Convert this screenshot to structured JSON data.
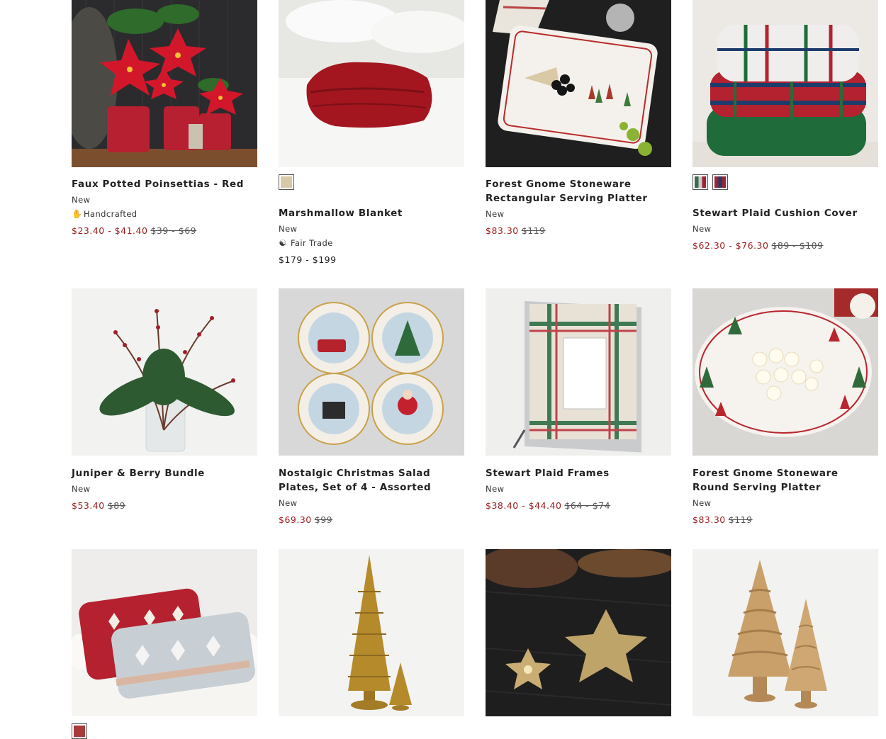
{
  "products": [
    {
      "title": "Faux Potted Poinsettias - Red",
      "tag": "New",
      "badge": "Handcrafted",
      "badge_icon": "hand-icon",
      "sale_price": "$23.40 - $41.40",
      "original_price": "$39 - $69"
    },
    {
      "title": "Marshmallow Blanket",
      "tag": "New",
      "badge": "Fair Trade",
      "badge_icon": "fair-trade-icon",
      "price": "$179 - $199",
      "swatches": [
        "#d8c9a8"
      ]
    },
    {
      "title": "Forest Gnome Stoneware Rectangular Serving Platter",
      "tag": "New",
      "sale_price": "$83.30",
      "original_price": "$119"
    },
    {
      "title": "Stewart Plaid Cushion Cover",
      "tag": "New",
      "sale_price": "$62.30 - $76.30",
      "original_price": "$89 - $109",
      "swatches": [
        "#3c6a4c",
        "#9b2333"
      ]
    },
    {
      "title": "Juniper & Berry Bundle",
      "tag": "New",
      "sale_price": "$53.40",
      "original_price": "$89"
    },
    {
      "title": "Nostalgic Christmas Salad Plates, Set of 4 - Assorted",
      "tag": "New",
      "sale_price": "$69.30",
      "original_price": "$99"
    },
    {
      "title": "Stewart Plaid Frames",
      "tag": "New",
      "sale_price": "$38.40 - $44.40",
      "original_price": "$64 - $74"
    },
    {
      "title": "Forest Gnome Stoneware Round Serving Platter",
      "tag": "New",
      "sale_price": "$83.30",
      "original_price": "$119"
    }
  ],
  "row3_swatches": [
    "#a83a3a"
  ],
  "colors": {
    "sale": "#9b1c1c",
    "text": "#222222"
  }
}
